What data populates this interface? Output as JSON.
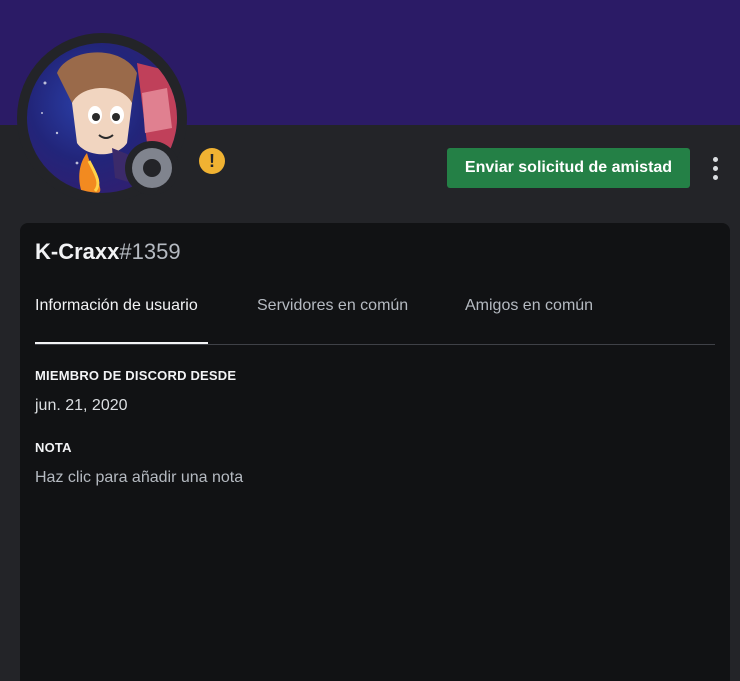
{
  "profile": {
    "username": "K-Craxx",
    "discriminator": "#1359",
    "status": "offline",
    "warning_badge": "!",
    "avatar_icon": "anime-character-avatar-icon"
  },
  "actions": {
    "send_friend_request": "Enviar solicitud de amistad",
    "more_icon": "more-vertical-icon"
  },
  "tabs": [
    {
      "label": "Información de usuario",
      "active": true
    },
    {
      "label": "Servidores en común",
      "active": false
    },
    {
      "label": "Amigos en común",
      "active": false
    }
  ],
  "user_info": {
    "member_since_title": "MIEMBRO DE DISCORD DESDE",
    "member_since_value": "jun. 21, 2020",
    "note_title": "NOTA",
    "note_placeholder": "Haz clic para añadir una nota"
  },
  "colors": {
    "banner": "#2b1b66",
    "button": "#248046",
    "warning": "#f0b232",
    "status_offline": "#80848e"
  }
}
